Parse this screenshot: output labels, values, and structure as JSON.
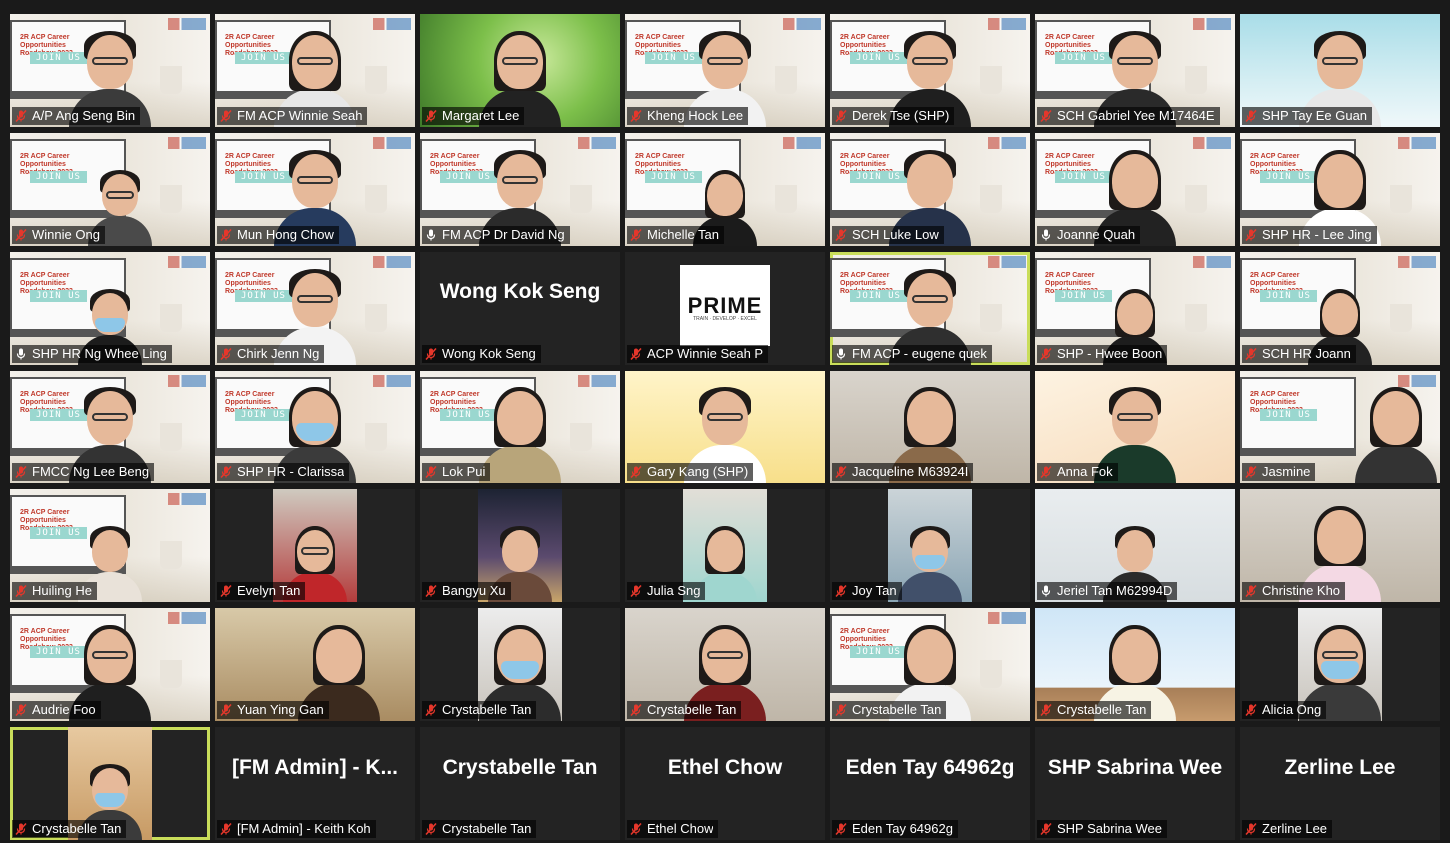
{
  "app": {
    "view": "Zoom gallery view",
    "accent_speaking": "#c9dd5a",
    "muted_icon": "mic-muted-icon",
    "muted_color": "#e5372b"
  },
  "slide_background": {
    "title": "2R ACP Career Opportunities Roadshow 2023",
    "join": "JOIN US"
  },
  "prime_logo": {
    "text": "PRIME",
    "sub": "TRAIN · DEVELOP · EXCEL"
  },
  "participants": [
    {
      "name": "A/P Ang Seng Bin",
      "bg": "slide",
      "muted": true
    },
    {
      "name": "FM ACP Winnie Seah",
      "bg": "slide",
      "muted": true
    },
    {
      "name": "Margaret Lee",
      "bg": "green",
      "muted": true
    },
    {
      "name": "Kheng Hock Lee",
      "bg": "slide",
      "muted": true
    },
    {
      "name": "Derek Tse (SHP)",
      "bg": "slide",
      "muted": true
    },
    {
      "name": "SCH Gabriel Yee M17464E",
      "bg": "slide",
      "muted": true
    },
    {
      "name": "SHP Tay Ee Guan",
      "bg": "sky",
      "muted": true
    },
    {
      "name": "Winnie Ong",
      "bg": "slide",
      "muted": true
    },
    {
      "name": "Mun Hong Chow",
      "bg": "slide",
      "muted": true
    },
    {
      "name": "FM ACP Dr David Ng",
      "bg": "slide",
      "muted": false
    },
    {
      "name": "Michelle Tan",
      "bg": "slide",
      "muted": true
    },
    {
      "name": "SCH Luke Low",
      "bg": "slide",
      "muted": true
    },
    {
      "name": "Joanne Quah",
      "bg": "slide",
      "muted": false
    },
    {
      "name": "SHP HR - Lee Jing",
      "bg": "slide",
      "muted": true
    },
    {
      "name": "SHP HR Ng Whee Ling",
      "bg": "slide",
      "muted": false
    },
    {
      "name": "Chirk Jenn Ng",
      "bg": "slide",
      "muted": true
    },
    {
      "name": "Wong Kok Seng",
      "bg": "dark",
      "muted": true,
      "big_name": "Wong Kok Seng"
    },
    {
      "name": "ACP Winnie Seah P",
      "bg": "prime",
      "muted": true
    },
    {
      "name": "FM ACP - eugene quek",
      "bg": "slide",
      "muted": false,
      "speaking": true
    },
    {
      "name": "SHP - Hwee Boon",
      "bg": "slide",
      "muted": true
    },
    {
      "name": "SCH HR Joann",
      "bg": "slide",
      "muted": true
    },
    {
      "name": "FMCC Ng Lee Beng",
      "bg": "slide",
      "muted": true
    },
    {
      "name": "SHP HR - Clarissa",
      "bg": "slide",
      "muted": true
    },
    {
      "name": "Lok Pui",
      "bg": "slide",
      "muted": true
    },
    {
      "name": "Gary Kang (SHP)",
      "bg": "yellow",
      "muted": true
    },
    {
      "name": "Jacqueline M63924I",
      "bg": "room",
      "muted": true
    },
    {
      "name": "Anna Fok",
      "bg": "floral",
      "muted": true
    },
    {
      "name": "Jasmine",
      "bg": "slide",
      "muted": true
    },
    {
      "name": "Huiling He",
      "bg": "slide",
      "muted": true
    },
    {
      "name": "Evelyn Tan",
      "bg": "phone1",
      "muted": true
    },
    {
      "name": "Bangyu Xu",
      "bg": "phone2",
      "muted": true
    },
    {
      "name": "Julia Sng",
      "bg": "phone3",
      "muted": true
    },
    {
      "name": "Joy Tan",
      "bg": "phone4",
      "muted": true
    },
    {
      "name": "Jeriel Tan M62994D",
      "bg": "white",
      "muted": false
    },
    {
      "name": "Christine Kho",
      "bg": "room",
      "muted": true
    },
    {
      "name": "Audrie Foo",
      "bg": "slide",
      "muted": true
    },
    {
      "name": "Yuan Ying Gan",
      "bg": "warm",
      "muted": true
    },
    {
      "name": "Crystabelle Tan",
      "bg": "phone5",
      "muted": true
    },
    {
      "name": "Crystabelle Tan",
      "bg": "room",
      "muted": true
    },
    {
      "name": "Crystabelle Tan",
      "bg": "slide",
      "muted": true
    },
    {
      "name": "Crystabelle Tan",
      "bg": "blue",
      "muted": true
    },
    {
      "name": "Alicia Ong",
      "bg": "phone5",
      "muted": true
    },
    {
      "name": "Crystabelle Tan",
      "bg": "phone6",
      "muted": true,
      "speaking": true
    },
    {
      "name": "[FM Admin] - Keith Koh",
      "bg": "dark",
      "muted": true,
      "big_name": "[FM Admin] - K..."
    },
    {
      "name": "Crystabelle Tan",
      "bg": "dark",
      "muted": true,
      "big_name": "Crystabelle Tan"
    },
    {
      "name": "Ethel Chow",
      "bg": "dark",
      "muted": true,
      "big_name": "Ethel Chow"
    },
    {
      "name": "Eden Tay 64962g",
      "bg": "dark",
      "muted": true,
      "big_name": "Eden Tay 64962g"
    },
    {
      "name": "SHP Sabrina Wee",
      "bg": "dark",
      "muted": true,
      "big_name": "SHP Sabrina Wee"
    },
    {
      "name": "Zerline Lee",
      "bg": "dark",
      "muted": true,
      "big_name": "Zerline Lee"
    }
  ]
}
